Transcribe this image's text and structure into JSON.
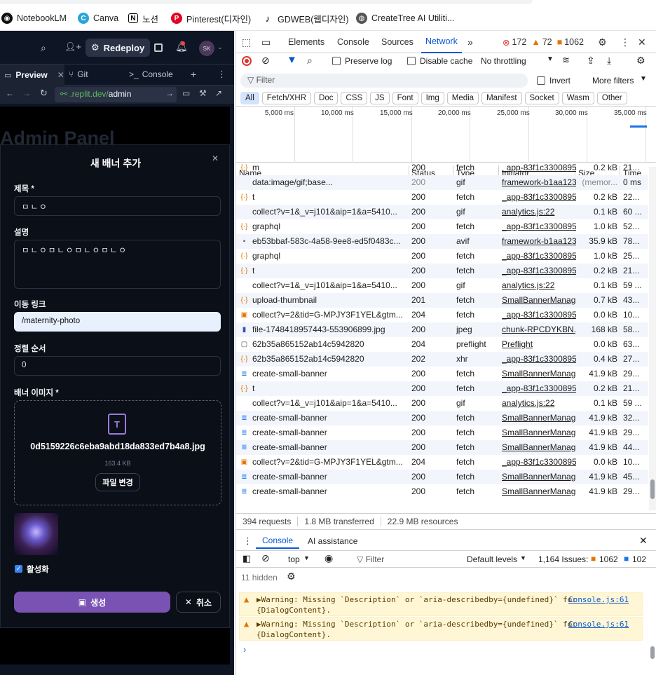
{
  "bookmarks": [
    {
      "label": "NotebookLM",
      "icon": "notebooklm-icon"
    },
    {
      "label": "Canva",
      "icon": "canva-icon"
    },
    {
      "label": "노션",
      "icon": "notion-icon"
    },
    {
      "label": "Pinterest(디자인)",
      "icon": "pinterest-icon"
    },
    {
      "label": "GDWEB(웹디자인)",
      "icon": "gdweb-icon"
    },
    {
      "label": "CreateTree AI Utiliti...",
      "icon": "globe-icon"
    }
  ],
  "replit": {
    "redeploy_label": "Redeploy",
    "avatar": "SK",
    "tabs": [
      "Preview",
      "Git",
      "Console"
    ],
    "url_prefix": ".replit.dev/",
    "url_path": "admin",
    "page_title": "Admin Panel"
  },
  "modal": {
    "title": "새 배너 추가",
    "title_label": "제목 *",
    "title_value": "ㅁㄴㅇ",
    "desc_label": "설명",
    "desc_value": "ㅁㄴㅇㅁㄴㅇㅁㄴㅇㅁㄴㅇ",
    "link_label": "이동 링크",
    "link_value": "/maternity-photo",
    "order_label": "정렬 순서",
    "order_value": "0",
    "image_label": "배너 이미지 *",
    "file_name": "0d5159226c6eba9abd18da833ed7b4a8.jpg",
    "file_size": "163.4 KB",
    "change_file": "파일 변경",
    "active_label": "활성화",
    "create_label": "생성",
    "cancel_label": "취소"
  },
  "devtools": {
    "tabs": [
      "Elements",
      "Console",
      "Sources",
      "Network"
    ],
    "errors": "172",
    "warnings": "72",
    "issues": "1062",
    "preserve_log": "Preserve log",
    "disable_cache": "Disable cache",
    "throttling": "No throttling",
    "filter_placeholder": "Filter",
    "invert": "Invert",
    "more_filters": "More filters",
    "filter_chips": [
      "All",
      "Fetch/XHR",
      "Doc",
      "CSS",
      "JS",
      "Font",
      "Img",
      "Media",
      "Manifest",
      "Socket",
      "Wasm",
      "Other"
    ],
    "timeline_ticks": [
      "5,000 ms",
      "10,000 ms",
      "15,000 ms",
      "20,000 ms",
      "25,000 ms",
      "30,000 ms",
      "35,000 ms"
    ],
    "columns": [
      "Name",
      "Status",
      "Type",
      "Initiator",
      "Size",
      "Time"
    ],
    "rows": [
      {
        "name": "m",
        "status": "200",
        "type": "fetch",
        "initiator": "_app-83f1c3300895",
        "size": "0.2 kB",
        "time": "21...",
        "icon": "fetch"
      },
      {
        "name": "data:image/gif;base...",
        "status": "200",
        "type": "gif",
        "initiator": "framework-b1aa123",
        "size": "(memor...",
        "time": "0 ms",
        "icon": "none"
      },
      {
        "name": "t",
        "status": "200",
        "type": "fetch",
        "initiator": "_app-83f1c3300895",
        "size": "0.2 kB",
        "time": "22...",
        "icon": "fetch"
      },
      {
        "name": "collect?v=1&_v=j101&aip=1&a=5410...",
        "status": "200",
        "type": "gif",
        "initiator": "analytics.js:22",
        "size": "0.1 kB",
        "time": "60 ...",
        "icon": "none"
      },
      {
        "name": "graphql",
        "status": "200",
        "type": "fetch",
        "initiator": "_app-83f1c3300895",
        "size": "1.0 kB",
        "time": "52...",
        "icon": "fetch"
      },
      {
        "name": "eb53bbaf-583c-4a58-9ee8-ed5f0483c...",
        "status": "200",
        "type": "avif",
        "initiator": "framework-b1aa123",
        "size": "35.9 kB",
        "time": "78...",
        "icon": "img"
      },
      {
        "name": "graphql",
        "status": "200",
        "type": "fetch",
        "initiator": "_app-83f1c3300895",
        "size": "1.0 kB",
        "time": "25...",
        "icon": "fetch"
      },
      {
        "name": "t",
        "status": "200",
        "type": "fetch",
        "initiator": "_app-83f1c3300895",
        "size": "0.2 kB",
        "time": "21...",
        "icon": "fetch"
      },
      {
        "name": "collect?v=1&_v=j101&aip=1&a=5410...",
        "status": "200",
        "type": "gif",
        "initiator": "analytics.js:22",
        "size": "0.1 kB",
        "time": "59 ...",
        "icon": "none"
      },
      {
        "name": "upload-thumbnail",
        "status": "201",
        "type": "fetch",
        "initiator": "SmallBannerManag",
        "size": "0.7 kB",
        "time": "43...",
        "icon": "fetch"
      },
      {
        "name": "collect?v=2&tid=G-MPJY3F1YEL&gtm...",
        "status": "204",
        "type": "fetch",
        "initiator": "_app-83f1c3300895",
        "size": "0.0 kB",
        "time": "10...",
        "icon": "fetch-box"
      },
      {
        "name": "file-1748418957443-553906899.jpg",
        "status": "200",
        "type": "jpeg",
        "initiator": "chunk-RPCDYKBN.js",
        "size": "168 kB",
        "time": "58...",
        "icon": "jpg"
      },
      {
        "name": "62b35a865152ab14c5942820",
        "status": "204",
        "type": "preflight",
        "initiator": "Preflight",
        "size": "0.0 kB",
        "time": "63...",
        "icon": "preflight"
      },
      {
        "name": "62b35a865152ab14c5942820",
        "status": "202",
        "type": "xhr",
        "initiator": "_app-83f1c3300895",
        "size": "0.4 kB",
        "time": "27...",
        "icon": "fetch"
      },
      {
        "name": "create-small-banner",
        "status": "200",
        "type": "fetch",
        "initiator": "SmallBannerManag",
        "size": "41.9 kB",
        "time": "29...",
        "icon": "doc"
      },
      {
        "name": "t",
        "status": "200",
        "type": "fetch",
        "initiator": "_app-83f1c3300895",
        "size": "0.2 kB",
        "time": "21...",
        "icon": "fetch"
      },
      {
        "name": "collect?v=1&_v=j101&aip=1&a=5410...",
        "status": "200",
        "type": "gif",
        "initiator": "analytics.js:22",
        "size": "0.1 kB",
        "time": "59 ...",
        "icon": "none"
      },
      {
        "name": "create-small-banner",
        "status": "200",
        "type": "fetch",
        "initiator": "SmallBannerManag",
        "size": "41.9 kB",
        "time": "32...",
        "icon": "doc"
      },
      {
        "name": "create-small-banner",
        "status": "200",
        "type": "fetch",
        "initiator": "SmallBannerManag",
        "size": "41.9 kB",
        "time": "29...",
        "icon": "doc"
      },
      {
        "name": "create-small-banner",
        "status": "200",
        "type": "fetch",
        "initiator": "SmallBannerManag",
        "size": "41.9 kB",
        "time": "44...",
        "icon": "doc"
      },
      {
        "name": "collect?v=2&tid=G-MPJY3F1YEL&gtm...",
        "status": "204",
        "type": "fetch",
        "initiator": "_app-83f1c3300895",
        "size": "0.0 kB",
        "time": "10...",
        "icon": "fetch-box"
      },
      {
        "name": "create-small-banner",
        "status": "200",
        "type": "fetch",
        "initiator": "SmallBannerManag",
        "size": "41.9 kB",
        "time": "45...",
        "icon": "doc"
      },
      {
        "name": "create-small-banner",
        "status": "200",
        "type": "fetch",
        "initiator": "SmallBannerManag",
        "size": "41.9 kB",
        "time": "29...",
        "icon": "doc"
      }
    ],
    "summary": {
      "requests": "394 requests",
      "transferred": "1.8 MB transferred",
      "resources": "22.9 MB resources"
    },
    "drawer_tabs": [
      "Console",
      "AI assistance"
    ],
    "console": {
      "context": "top",
      "filter": "Filter",
      "levels": "Default levels",
      "issues_label": "1,164 Issues:",
      "issues_a": "1062",
      "issues_b": "102",
      "hidden": "11 hidden"
    },
    "warnings_list": [
      {
        "line1": "▶Warning: Missing `Description` or `aria-describedby={undefined}` for",
        "line2": "{DialogContent}.",
        "source": "Console.js:61"
      },
      {
        "line1": "▶Warning: Missing `Description` or `aria-describedby={undefined}` for",
        "line2": "{DialogContent}.",
        "source": "Console.js:61"
      }
    ]
  }
}
